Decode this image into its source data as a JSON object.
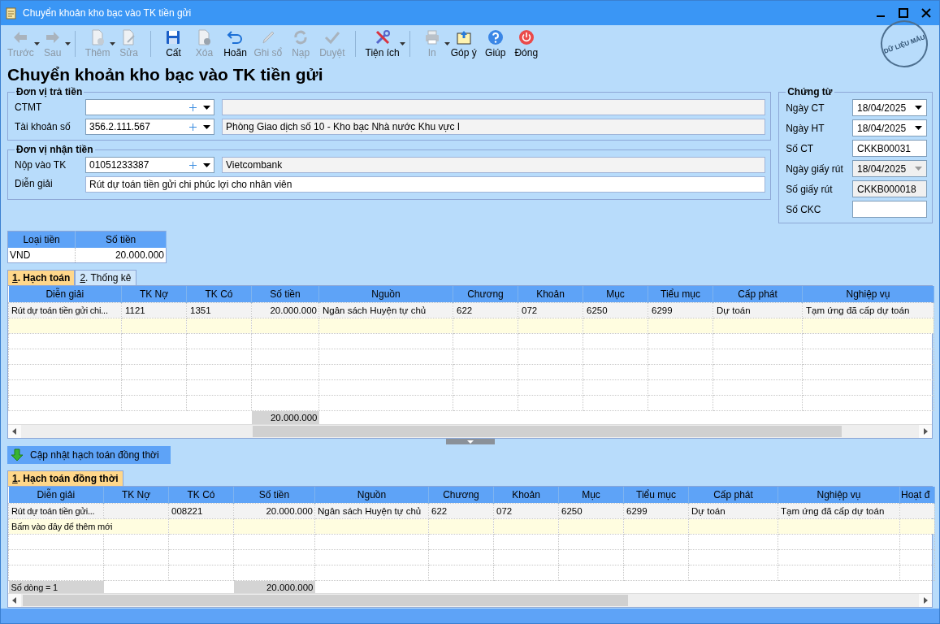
{
  "window": {
    "title": "Chuyển khoản kho bạc vào TK tiền gửi"
  },
  "toolbar": [
    {
      "kind": "back",
      "label": "Trước",
      "disabled": true,
      "dropdown": true
    },
    {
      "kind": "forward",
      "label": "Sau",
      "disabled": true,
      "dropdown": true
    },
    {
      "kind": "add",
      "label": "Thêm",
      "disabled": true,
      "dropdown": true
    },
    {
      "kind": "edit",
      "label": "Sửa",
      "disabled": true,
      "dropdown": false
    },
    {
      "kind": "save",
      "label": "Cất",
      "disabled": false,
      "dropdown": false
    },
    {
      "kind": "delete",
      "label": "Xóa",
      "disabled": true,
      "dropdown": false
    },
    {
      "kind": "undo",
      "label": "Hoãn",
      "disabled": false,
      "dropdown": false
    },
    {
      "kind": "post",
      "label": "Ghi sổ",
      "disabled": true,
      "dropdown": false
    },
    {
      "kind": "reload",
      "label": "Nạp",
      "disabled": true,
      "dropdown": false
    },
    {
      "kind": "approve",
      "label": "Duyệt",
      "disabled": true,
      "dropdown": false
    },
    {
      "kind": "tools",
      "label": "Tiện ích",
      "disabled": false,
      "dropdown": true
    },
    {
      "kind": "print",
      "label": "In",
      "disabled": true,
      "dropdown": true
    },
    {
      "kind": "feedback",
      "label": "Góp ý",
      "disabled": false,
      "dropdown": false
    },
    {
      "kind": "help",
      "label": "Giúp",
      "disabled": false,
      "dropdown": false
    },
    {
      "kind": "close",
      "label": "Đóng",
      "disabled": false,
      "dropdown": false
    }
  ],
  "stamp": "DỮ LIỆU MẪU",
  "page_title": "Chuyển khoản kho bạc vào TK tiền gửi",
  "payer": {
    "title": "Đơn vị trả tiền",
    "rows": [
      {
        "label": "CTMT"
      },
      {
        "label": "Tài khoản số",
        "value": "356.2.111.567",
        "name": "Phòng Giao dịch số 10 - Kho bạc Nhà nước Khu vực I"
      }
    ]
  },
  "receiver": {
    "title": "Đơn vị nhận tiền",
    "account": {
      "label": "Nộp vào TK",
      "value": "01051233387",
      "name": "Vietcombank"
    },
    "description": {
      "label": "Diễn giải",
      "value": "Rút dự toán tiền gửi chi phúc lợi cho nhân viên"
    }
  },
  "voucher": {
    "title": "Chứng từ",
    "fields": [
      {
        "kind": "date",
        "label": "Ngày CT",
        "value": "18/04/2025",
        "disabled": false
      },
      {
        "kind": "date",
        "label": "Ngày HT",
        "value": "18/04/2025",
        "disabled": false
      },
      {
        "kind": "text",
        "label": "Số CT",
        "value": "CKKB00031",
        "disabled": false
      },
      {
        "kind": "date",
        "label": "Ngày giấy rút",
        "value": "18/04/2025",
        "disabled": true
      },
      {
        "kind": "text",
        "label": "Số giấy rút",
        "value": "CKKB000018",
        "disabled": true
      },
      {
        "kind": "text",
        "label": "Số CKC",
        "disabled": false
      }
    ]
  },
  "currency": {
    "columns": [
      "Loại tiền",
      "Số tiền"
    ],
    "rows": [
      [
        "VND",
        "20.000.000"
      ]
    ]
  },
  "tabs": [
    {
      "key": "1",
      "label": ". Hạch toán",
      "selected": true
    },
    {
      "key": "2",
      "label": ". Thống kê",
      "selected": false
    }
  ],
  "grid": {
    "columns": [
      "Diễn giải",
      "TK Nợ",
      "TK Có",
      "Số tiền",
      "Nguồn",
      "Chương",
      "Khoản",
      "Mục",
      "Tiểu mục",
      "Cấp phát",
      "Nghiệp vụ"
    ],
    "rows": [
      [
        "Rút dự toán tiền gửi chi...",
        "1121",
        "1351",
        "20.000.000",
        "Ngân sách Huyện tự chủ",
        "622",
        "072",
        "6250",
        "6299",
        "Dự toán",
        "Tạm ứng đã cấp dự toán"
      ]
    ],
    "total": "20.000.000"
  },
  "update_button": "Cập nhật hạch toán đồng thời",
  "tabs2": [
    {
      "key": "1",
      "label": ". Hạch toán đồng thời",
      "selected": true
    }
  ],
  "grid2": {
    "columns": [
      "Diễn giải",
      "TK Nợ",
      "TK Có",
      "Số tiền",
      "Nguồn",
      "Chương",
      "Khoản",
      "Mục",
      "Tiểu mục",
      "Cấp phát",
      "Nghiệp vụ",
      "Hoạt đ"
    ],
    "rows": [
      [
        "Rút dự toán tiền gửi...",
        null,
        "008221",
        "20.000.000",
        "Ngân sách Huyện tự chủ",
        "622",
        "072",
        "6250",
        "6299",
        "Dự toán",
        "Tạm ứng đã cấp dự toán",
        null
      ]
    ],
    "new_row_hint": "Bấm vào đây để thêm mới",
    "row_count": "Số dòng = 1",
    "total": "20.000.000"
  }
}
